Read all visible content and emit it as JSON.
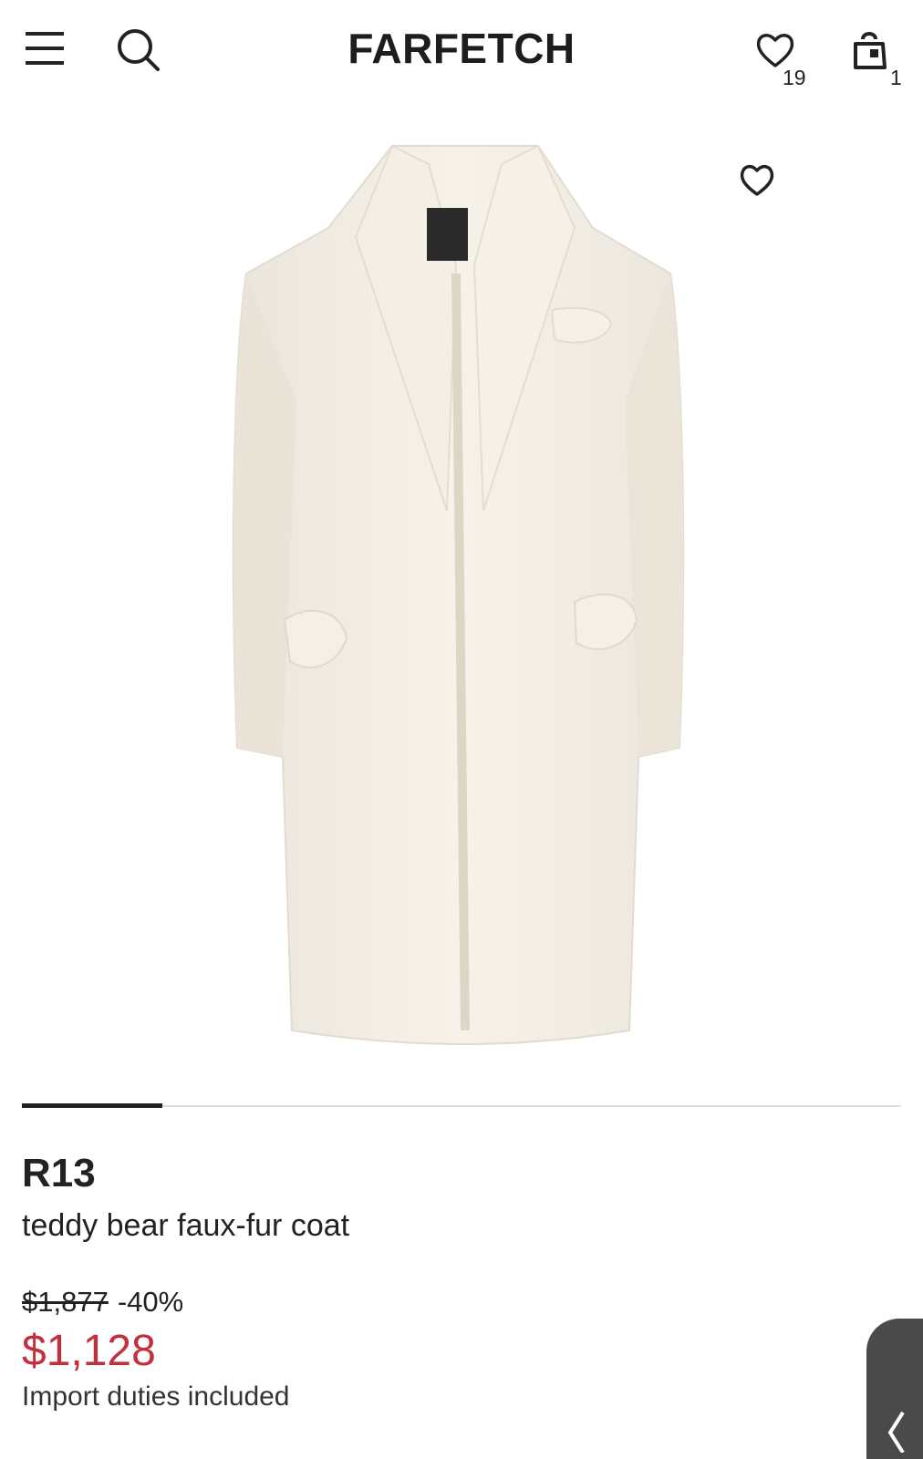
{
  "header": {
    "logo": "FARFETCH",
    "wishlist_count": "19",
    "bag_count": "1",
    "icons": [
      "menu-icon",
      "search-icon",
      "heart-icon",
      "shopping-bag-icon"
    ]
  },
  "product": {
    "image_icon": "faux-fur-coat-image",
    "brand": "R13",
    "name": "teddy bear faux-fur coat",
    "original_price": "$1,877",
    "discount": "-40%",
    "sale_price": "$1,128",
    "duties_note": "Import duties included"
  },
  "gallery": {
    "current_image_progress": 0.16
  },
  "colors": {
    "sale_price": "#c2313b",
    "text": "#222222",
    "side_tab": "#4a4a4a"
  }
}
